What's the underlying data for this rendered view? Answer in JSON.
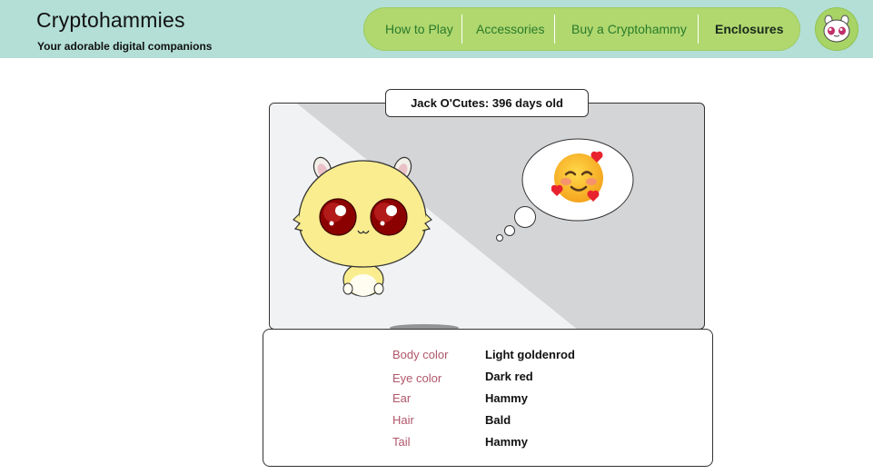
{
  "header": {
    "title": "Cryptohammies",
    "subtitle": "Your adorable digital companions",
    "background": "#b3dfd6"
  },
  "nav": {
    "items": [
      {
        "label": "How to Play",
        "active": false
      },
      {
        "label": "Accessories",
        "active": false
      },
      {
        "label": "Buy a Cryptohammy",
        "active": false
      },
      {
        "label": "Enclosures",
        "active": true
      }
    ],
    "pill_color": "#b0d86f"
  },
  "profile": {
    "icon": "hamster-avatar-icon"
  },
  "pet": {
    "name_age": "Jack O'Cutes: 396 days old",
    "thought_icon": "smiling-face-with-hearts-icon",
    "body_hex": "#f9ed8f",
    "eye_hex": "#8b0000"
  },
  "attributes": [
    {
      "label": "Body color",
      "value": "Light goldenrod"
    },
    {
      "label": "Eye color",
      "value": "Dark red"
    },
    {
      "label": "Ear",
      "value": "Hammy"
    },
    {
      "label": "Hair",
      "value": "Bald"
    },
    {
      "label": "Tail",
      "value": "Hammy"
    }
  ]
}
